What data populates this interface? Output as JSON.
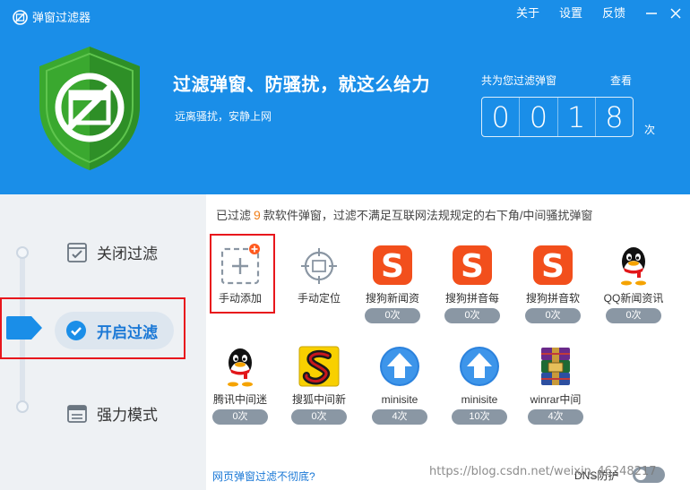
{
  "app": {
    "title": "弹窗过滤器"
  },
  "header_menu": [
    "关于",
    "设置",
    "反馈"
  ],
  "header": {
    "headline": "过滤弹窗、防骚扰，就这么给力",
    "subtitle": "远离骚扰，安静上网",
    "counter_label": "共为您过滤弹窗",
    "view_link": "查看",
    "digits": [
      "0",
      "0",
      "1",
      "8"
    ],
    "unit": "次"
  },
  "modes": [
    {
      "id": "close",
      "label": "关闭过滤",
      "icon": "checklist-icon",
      "active": false
    },
    {
      "id": "open",
      "label": "开启过滤",
      "icon": "check-circle-icon",
      "active": true
    },
    {
      "id": "strong",
      "label": "强力模式",
      "icon": "window-icon",
      "active": false
    }
  ],
  "info": {
    "prefix": "已过滤",
    "count": "9",
    "suffix": "款软件弹窗，过滤不满足互联网法规规定的右下角/中间骚扰弹窗"
  },
  "tiles": [
    {
      "label": "手动添加",
      "icon": "add-icon"
    },
    {
      "label": "手动定位",
      "icon": "crosshair-icon"
    },
    {
      "label": "搜狗新闻资",
      "icon": "sogou-icon",
      "count": "0次"
    },
    {
      "label": "搜狗拼音每",
      "icon": "sogou-icon",
      "count": "0次"
    },
    {
      "label": "搜狗拼音软",
      "icon": "sogou-icon",
      "count": "0次"
    },
    {
      "label": "QQ新闻资讯",
      "icon": "qq-penguin-icon",
      "count": "0次"
    },
    {
      "label": "腾讯中间迷",
      "icon": "qq-penguin-icon",
      "count": "0次"
    },
    {
      "label": "搜狐中间新",
      "icon": "sohu-icon",
      "count": "0次"
    },
    {
      "label": "minisite",
      "icon": "upload-arrow-icon",
      "count": "4次"
    },
    {
      "label": "minisite",
      "icon": "upload-arrow-icon",
      "count": "10次"
    },
    {
      "label": "winrar中间",
      "icon": "winrar-icon",
      "count": "4次"
    }
  ],
  "bottom": {
    "link": "网页弹窗过滤不彻底?",
    "dns_label": "DNS防护",
    "watermark": "https://blog.csdn.net/weixin_46248217"
  },
  "colors": {
    "header_blue": "#1a8ee8",
    "accent_orange": "#f07f1a",
    "highlight_red": "#e8161c"
  }
}
